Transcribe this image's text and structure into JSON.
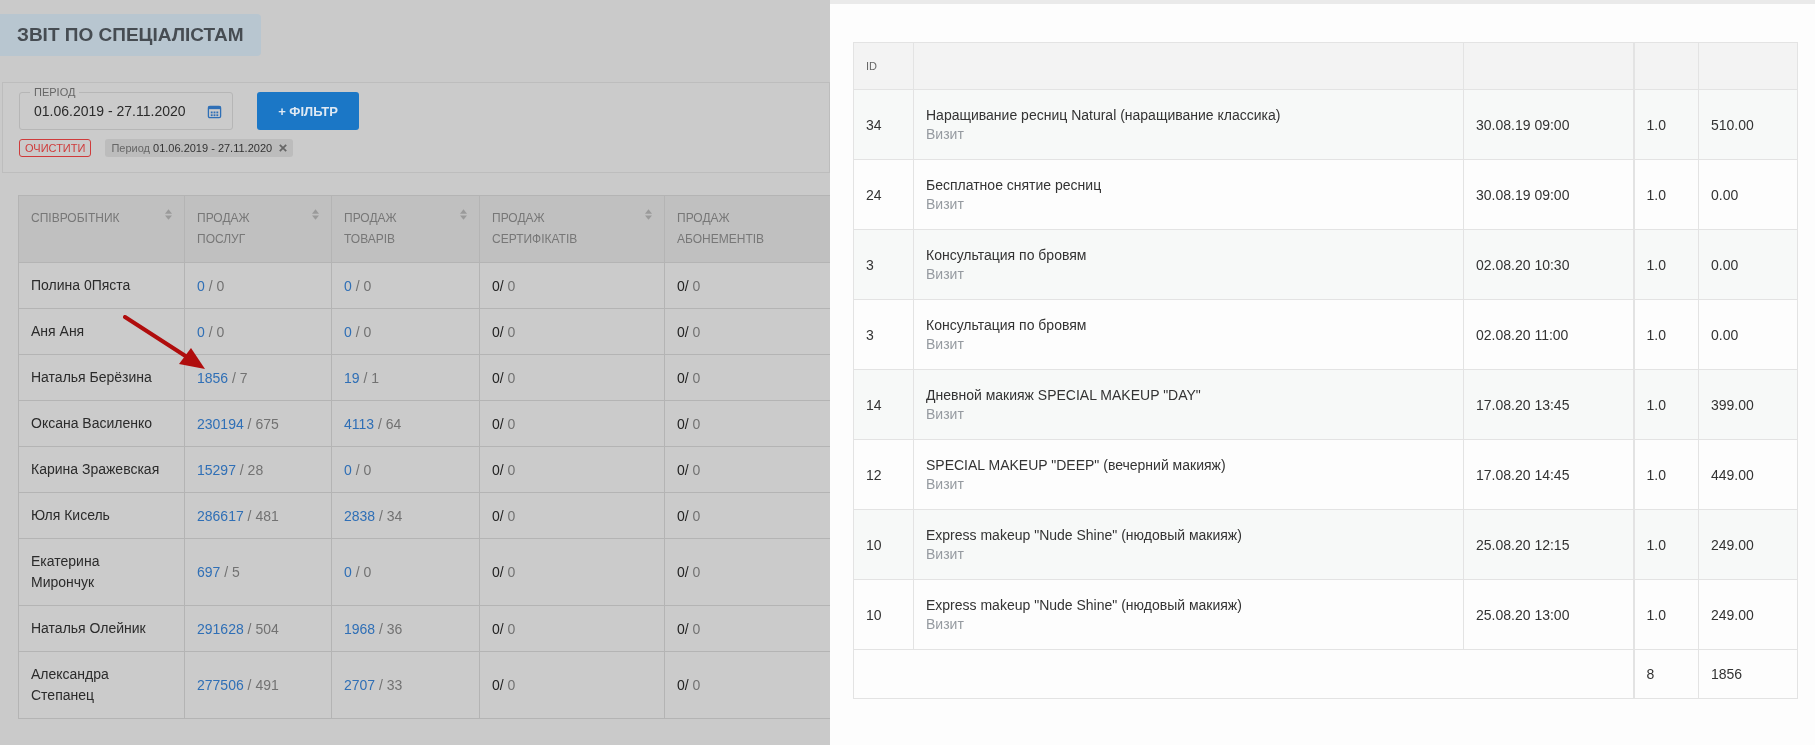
{
  "page_title": "ЗВІТ ПО СПЕЦІАЛІСТАМ",
  "filters": {
    "period_field": {
      "label": "ПЕРІОД",
      "value": "01.06.2019 - 27.11.2020"
    },
    "filter_button": "+ ФІЛЬТР",
    "clear_button": "ОЧИСТИТИ",
    "chips": [
      {
        "label": "Период",
        "value": "01.06.2019 - 27.11.2020"
      }
    ]
  },
  "staff_table": {
    "columns": [
      {
        "label": "СПІВРОБІТНИК",
        "sortable": true
      },
      {
        "label": "ПРОДАЖ ПОСЛУГ",
        "sortable": true
      },
      {
        "label": "ПРОДАЖ ТОВАРІВ",
        "sortable": true
      },
      {
        "label": "ПРОДАЖ СЕРТИФІКАТІВ",
        "sortable": true
      },
      {
        "label": "ПРОДАЖ АБОНЕМЕНТІВ"
      }
    ],
    "rows": [
      {
        "cells": [
          {
            "kind": "name",
            "main": "Полина 0Пяста"
          },
          {
            "kind": "link",
            "main": "0",
            "rest": "/ 0"
          },
          {
            "kind": "link",
            "main": "0",
            "rest": "/ 0"
          },
          {
            "kind": "plain",
            "main": "0/",
            "rest": "0"
          },
          {
            "kind": "plain",
            "main": "0/",
            "rest": "0"
          }
        ]
      },
      {
        "cells": [
          {
            "kind": "name",
            "main": "Аня Аня"
          },
          {
            "kind": "link",
            "main": "0",
            "rest": "/ 0"
          },
          {
            "kind": "link",
            "main": "0",
            "rest": "/ 0"
          },
          {
            "kind": "plain",
            "main": "0/",
            "rest": "0"
          },
          {
            "kind": "plain",
            "main": "0/",
            "rest": "0"
          }
        ]
      },
      {
        "cells": [
          {
            "kind": "name",
            "main": "Наталья Берёзина"
          },
          {
            "kind": "link",
            "main": "1856",
            "rest": "/ 7"
          },
          {
            "kind": "link",
            "main": "19",
            "rest": "/ 1"
          },
          {
            "kind": "plain",
            "main": "0/",
            "rest": "0"
          },
          {
            "kind": "plain",
            "main": "0/",
            "rest": "0"
          }
        ]
      },
      {
        "cells": [
          {
            "kind": "name",
            "main": "Оксана Василенко"
          },
          {
            "kind": "link",
            "main": "230194",
            "rest": "/ 675"
          },
          {
            "kind": "link",
            "main": "4113",
            "rest": "/ 64"
          },
          {
            "kind": "plain",
            "main": "0/",
            "rest": "0"
          },
          {
            "kind": "plain",
            "main": "0/",
            "rest": "0"
          }
        ]
      },
      {
        "cells": [
          {
            "kind": "name",
            "main": "Карина Зражевская"
          },
          {
            "kind": "link",
            "main": "15297",
            "rest": "/ 28"
          },
          {
            "kind": "link",
            "main": "0",
            "rest": "/ 0"
          },
          {
            "kind": "plain",
            "main": "0/",
            "rest": "0"
          },
          {
            "kind": "plain",
            "main": "0/",
            "rest": "0"
          }
        ]
      },
      {
        "cells": [
          {
            "kind": "name",
            "main": "Юля Кисель"
          },
          {
            "kind": "link",
            "main": "286617",
            "rest": "/ 481"
          },
          {
            "kind": "link",
            "main": "2838",
            "rest": "/ 34"
          },
          {
            "kind": "plain",
            "main": "0/",
            "rest": "0"
          },
          {
            "kind": "plain",
            "main": "0/",
            "rest": "0"
          }
        ]
      },
      {
        "cells": [
          {
            "kind": "name",
            "main": "Екатерина Мирончук"
          },
          {
            "kind": "link",
            "main": "697",
            "rest": "/ 5"
          },
          {
            "kind": "link",
            "main": "0",
            "rest": "/ 0"
          },
          {
            "kind": "plain",
            "main": "0/",
            "rest": "0"
          },
          {
            "kind": "plain",
            "main": "0/",
            "rest": "0"
          }
        ]
      },
      {
        "cells": [
          {
            "kind": "name",
            "main": "Наталья Олейник"
          },
          {
            "kind": "link",
            "main": "291628",
            "rest": "/ 504"
          },
          {
            "kind": "link",
            "main": "1968",
            "rest": "/ 36"
          },
          {
            "kind": "plain",
            "main": "0/",
            "rest": "0"
          },
          {
            "kind": "plain",
            "main": "0/",
            "rest": "0"
          }
        ]
      },
      {
        "cells": [
          {
            "kind": "name",
            "main": "Александра Степанец"
          },
          {
            "kind": "link",
            "main": "277506",
            "rest": "/ 491"
          },
          {
            "kind": "link",
            "main": "2707",
            "rest": "/ 33"
          },
          {
            "kind": "plain",
            "main": "0/",
            "rest": "0"
          },
          {
            "kind": "plain",
            "main": "0/",
            "rest": "0"
          }
        ]
      }
    ]
  },
  "detail_table": {
    "columns": [
      "ID"
    ],
    "rows": [
      {
        "id": "34",
        "service": "Наращивание ресниц Natural (наращивание классика)",
        "type": "Визит",
        "date": "30.08.19 09:00",
        "qty": "1.0",
        "sum": "510.00"
      },
      {
        "id": "24",
        "service": "Бесплатное снятие ресниц",
        "type": "Визит",
        "date": "30.08.19 09:00",
        "qty": "1.0",
        "sum": "0.00"
      },
      {
        "id": "3",
        "service": "Консультация по бровям",
        "type": "Визит",
        "date": "02.08.20 10:30",
        "qty": "1.0",
        "sum": "0.00"
      },
      {
        "id": "3",
        "service": "Консультация по бровям",
        "type": "Визит",
        "date": "02.08.20 11:00",
        "qty": "1.0",
        "sum": "0.00"
      },
      {
        "id": "14",
        "service": "Дневной макияж SPECIAL MAKEUP \"DAY\"",
        "type": "Визит",
        "date": "17.08.20 13:45",
        "qty": "1.0",
        "sum": "399.00"
      },
      {
        "id": "12",
        "service": "SPECIAL MAKEUP \"DEEP\" (вечерний макияж)",
        "type": "Визит",
        "date": "17.08.20 14:45",
        "qty": "1.0",
        "sum": "449.00"
      },
      {
        "id": "10",
        "service": "Express makeup \"Nude Shine\" (нюдовый макияж)",
        "type": "Визит",
        "date": "25.08.20 12:15",
        "qty": "1.0",
        "sum": "249.00"
      },
      {
        "id": "10",
        "service": "Express makeup \"Nude Shine\" (нюдовый макияж)",
        "type": "Визит",
        "date": "25.08.20 13:00",
        "qty": "1.0",
        "sum": "249.00"
      }
    ],
    "totals": {
      "qty": "8",
      "sum": "1856"
    }
  }
}
